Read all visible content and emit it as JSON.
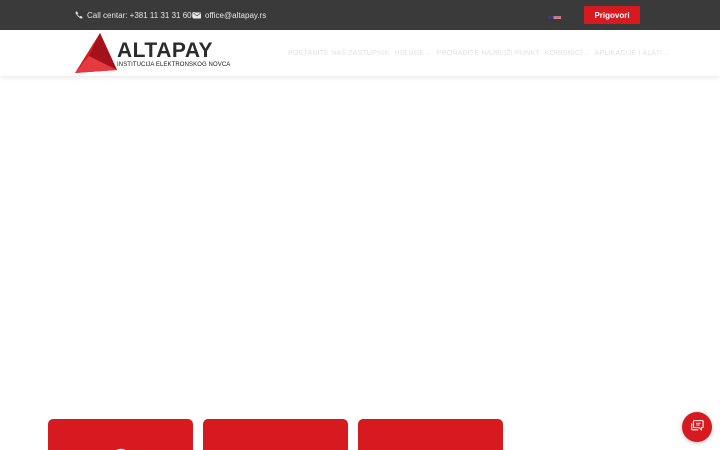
{
  "topbar": {
    "phone_text": "Call centar: +381 11 31 31 600",
    "email_text": "office@altapay.rs",
    "language_flag": "us-flag",
    "complaints_label": "Prigovori"
  },
  "header": {
    "logo": {
      "alta": "ALTA",
      "pay": "PAY",
      "tagline": "INSTITUCIJA ELEKTRONSKOG NOVCA"
    },
    "nav_items": [
      {
        "label": "POSTANITE NAŠ ZASTUPNIK",
        "has_caret": false
      },
      {
        "label": "USLUGE",
        "has_caret": true
      },
      {
        "label": "PRONAĐITE NAJBLIŽI PUNKT",
        "has_caret": false
      },
      {
        "label": "KORISNICI",
        "has_caret": true
      },
      {
        "label": "APLIKACIJE I ALATI",
        "has_caret": true
      }
    ]
  },
  "cards": [
    {
      "icon": "card-icon"
    },
    {
      "icon": "card-icon"
    },
    {
      "icon": "card-icon"
    }
  ],
  "chat": {
    "icon": "chat-icon"
  },
  "colors": {
    "brand_red": "#d71920",
    "topbar_bg": "#3a3a3a",
    "logo_dark": "#2b2b2b"
  }
}
